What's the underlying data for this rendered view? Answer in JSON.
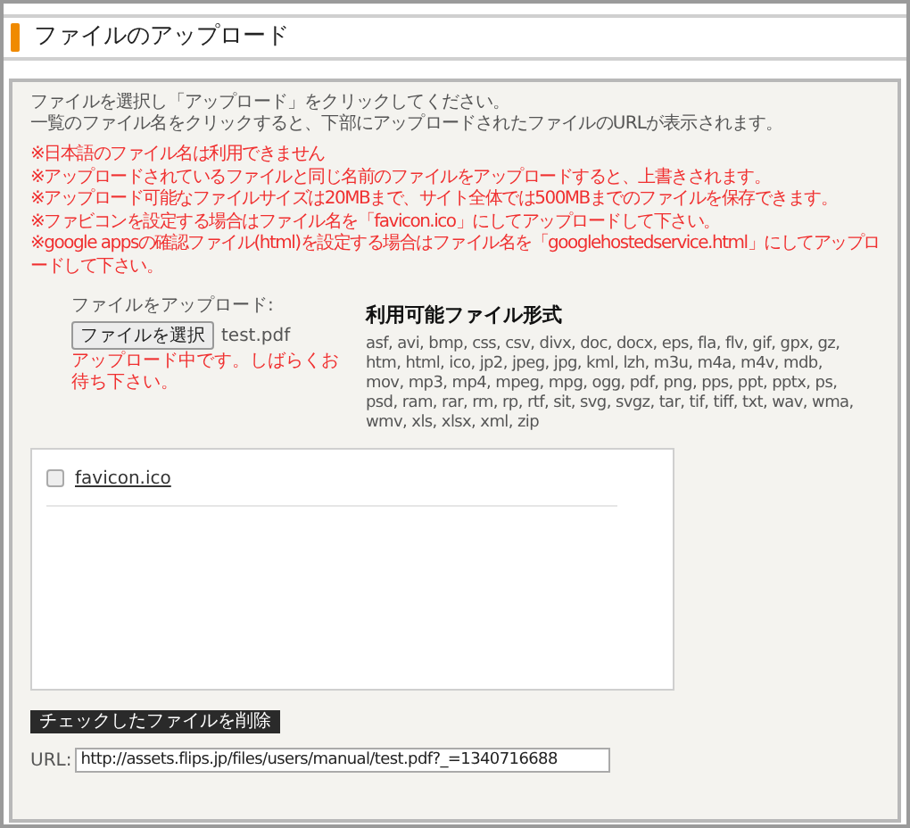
{
  "page_title": "ファイルのアップロード",
  "intro": [
    "ファイルを選択し「アップロード」をクリックしてください。",
    "一覧のファイル名をクリックすると、下部にアップロードされたファイルのURLが表示されます。"
  ],
  "notes": [
    "※日本語のファイル名は利用できません",
    "※アップロードされているファイルと同じ名前のファイルをアップロードすると、上書きされます。",
    "※アップロード可能なファイルサイズは20MBまで、サイト全体では500MBまでのファイルを保存できます。",
    "※ファビコンを設定する場合はファイル名を「favicon.ico」にしてアップロードして下さい。",
    "※google appsの確認ファイル(html)を設定する場合はファイル名を「googlehostedservice.html」にしてアップロードして下さい。"
  ],
  "upload": {
    "label": "ファイルをアップロード:",
    "button": "ファイルを選択",
    "file_name": "test.pdf",
    "status": "アップロード中です。しばらくお待ち下さい。"
  },
  "formats": {
    "heading": "利用可能ファイル形式",
    "list": "asf, avi, bmp, css, csv, divx, doc, docx, eps, fla, flv, gif, gpx, gz, htm, html, ico, jp2, jpeg, jpg, kml, lzh, m3u, m4a, m4v, mdb, mov, mp3, mp4, mpeg, mpg, ogg, pdf, png, pps, ppt, pptx, ps, psd, ram, rar, rm, rp, rtf, sit, svg, svgz, tar, tif, tiff, txt, wav, wma, wmv, xls, xlsx, xml, zip"
  },
  "files": [
    {
      "name": "favicon.ico",
      "checked": false
    }
  ],
  "delete_button": "チェックしたファイルを削除",
  "url": {
    "label": "URL:",
    "value": "http://assets.flips.jp/files/users/manual/test.pdf?_=1340716688"
  }
}
